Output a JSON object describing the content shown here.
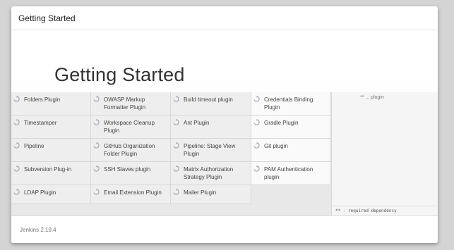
{
  "dialog": {
    "header_title": "Getting Started",
    "banner_title": "Getting Started",
    "footer_version": "Jenkins 2.19.4"
  },
  "plugins": {
    "rows": [
      [
        "Folders Plugin",
        "OWASP Markup Formatter Plugin",
        "Build timeout plugin",
        "Credentials Binding Plugin"
      ],
      [
        "Timestamper",
        "Workspace Cleanup Plugin",
        "Ant Plugin",
        "Gradle Plugin"
      ],
      [
        "Pipeline",
        "GitHub Organization Folder Plugin",
        "Pipeline: Stage View Plugin",
        "Git plugin"
      ],
      [
        "Subversion Plug-in",
        "SSH Slaves plugin",
        "Matrix Authorization Strategy Plugin",
        "PAM Authentication plugin"
      ],
      [
        "LDAP Plugin",
        "Email Extension Plugin",
        "Mailer Plugin",
        ""
      ]
    ]
  },
  "panel": {
    "top_text": "** ... plugin",
    "required_note": "** - required dependency"
  },
  "icons": {
    "status": "spinner-icon"
  },
  "colors": {
    "banner_text": "#333333",
    "grid_bg": "#eeeeee"
  }
}
